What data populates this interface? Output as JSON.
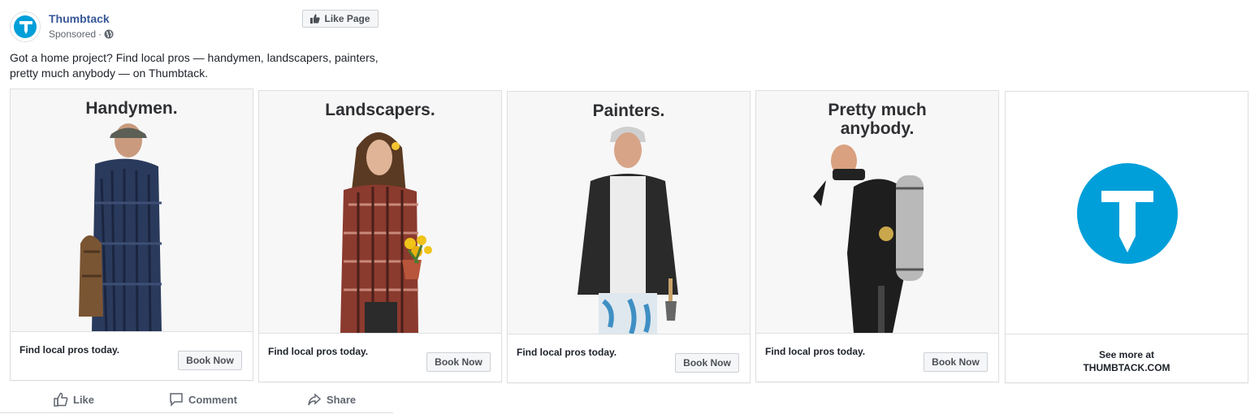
{
  "post": {
    "page_name": "Thumbtack",
    "sponsored": "Sponsored",
    "separator": "·",
    "like_page": "Like Page",
    "text_line1": "Got a home project? Find local pros — handymen, landscapers, painters,",
    "text_line2": "pretty much anybody — on Thumbtack."
  },
  "cards": [
    {
      "headline": "Handymen.",
      "cta_text": "Find local pros today.",
      "button": "Book Now"
    },
    {
      "headline": "Landscapers.",
      "cta_text": "Find local pros today.",
      "button": "Book Now"
    },
    {
      "headline": "Painters.",
      "cta_text": "Find local pros today.",
      "button": "Book Now"
    },
    {
      "headline": "Pretty much\nanybody.",
      "cta_text": "Find local pros today.",
      "button": "Book Now"
    }
  ],
  "end_card": {
    "text": "See more at\nTHUMBTACK.COM"
  },
  "actions": {
    "like": "Like",
    "comment": "Comment",
    "share": "Share"
  },
  "colors": {
    "brand": "#009fd9",
    "link": "#385898"
  }
}
